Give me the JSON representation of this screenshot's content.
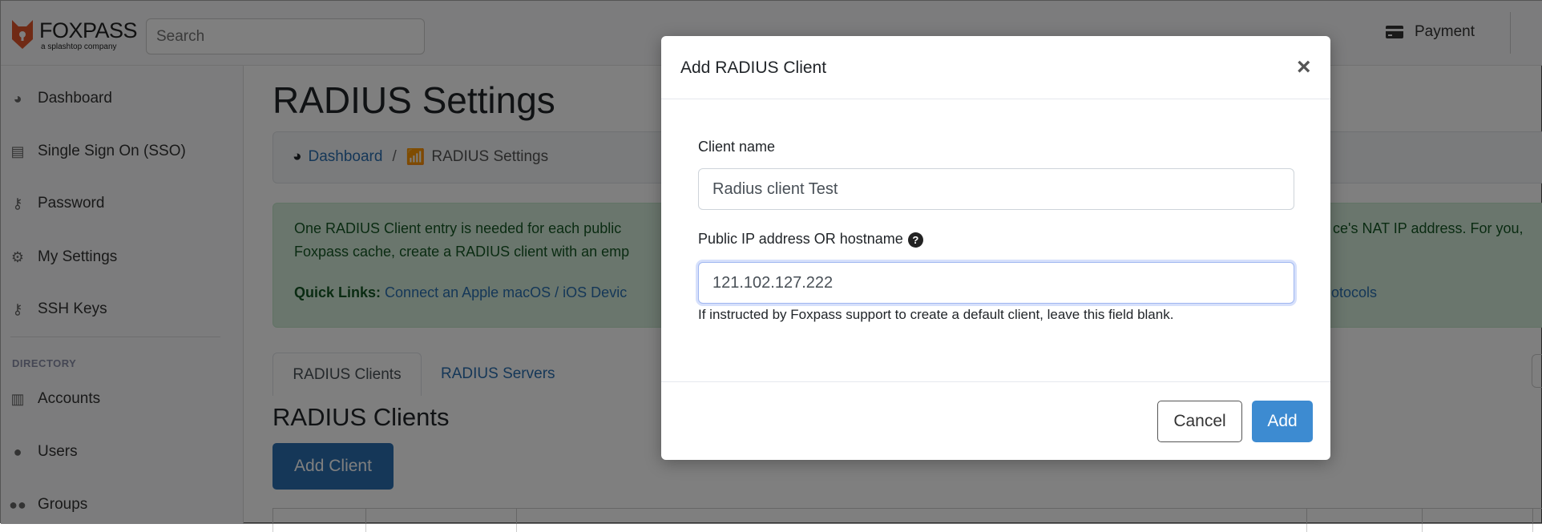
{
  "header": {
    "brand": "FOXPASS",
    "brand_sub": "a splashtop company",
    "search_placeholder": "Search",
    "payment": "Payment",
    "icons": {
      "logo": "fox-shield-logo",
      "payment": "credit-card-icon"
    }
  },
  "sidebar": {
    "items": [
      {
        "label": "Dashboard",
        "icon": "tachometer-icon"
      },
      {
        "label": "Single Sign On (SSO)",
        "icon": "id-card-icon"
      },
      {
        "label": "Password",
        "icon": "key-icon"
      },
      {
        "label": "My Settings",
        "icon": "cogs-icon"
      },
      {
        "label": "SSH Keys",
        "icon": "key-icon"
      }
    ],
    "section": "DIRECTORY",
    "directory_items": [
      {
        "label": "Accounts",
        "icon": "building-icon"
      },
      {
        "label": "Users",
        "icon": "user-icon"
      },
      {
        "label": "Groups",
        "icon": "users-icon"
      }
    ]
  },
  "main": {
    "title": "RADIUS Settings",
    "breadcrumb": {
      "home": "Dashboard",
      "sep": "/",
      "current": "RADIUS Settings"
    },
    "alert": {
      "line1": "One RADIUS Client entry is needed for each public",
      "line1_right": "ce's NAT IP address. For you,",
      "line2": "Foxpass cache, create a RADIUS client with an emp",
      "quick_label": "Quick Links:",
      "quick_link": "Connect an Apple macOS / iOS Devic",
      "quick_right": "otocols"
    },
    "tabs": [
      {
        "label": "RADIUS Clients",
        "active": true
      },
      {
        "label": "RADIUS Servers",
        "active": false
      }
    ],
    "section_title": "RADIUS Clients",
    "add_client": "Add Client"
  },
  "modal": {
    "title": "Add RADIUS Client",
    "close": "×",
    "client_name_label": "Client name",
    "client_name_value": "Radius client Test",
    "ip_label": "Public IP address OR hostname",
    "help_glyph": "?",
    "ip_value": "121.102.127.222",
    "help_text": "If instructed by Foxpass support to create a default client, leave this field blank.",
    "cancel": "Cancel",
    "add": "Add"
  },
  "colors": {
    "primary": "#3d8bd1",
    "link": "#2a6fb0",
    "alert_bg": "#d4edda",
    "alert_text": "#155724",
    "brand": "#e0552b"
  }
}
